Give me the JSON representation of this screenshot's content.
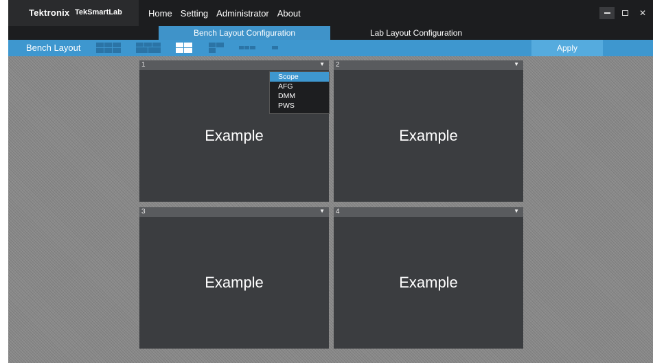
{
  "window": {
    "brand": "Tektronix",
    "app_name": "TekSmartLab",
    "menu": [
      "Home",
      "Setting",
      "Administrator",
      "About"
    ],
    "controls": [
      "minimize-icon",
      "maximize-icon",
      "close-icon"
    ]
  },
  "tabs": {
    "bench": "Bench Layout Configuration",
    "lab": "Lab Layout Configuration",
    "active": "bench"
  },
  "toolbar": {
    "label": "Bench Layout",
    "layouts": [
      "grid-2x3",
      "grid-2x3-alt",
      "grid-2x2",
      "grid-3-split",
      "row-3",
      "single"
    ],
    "selected_layout": "grid-2x2",
    "apply_label": "Apply"
  },
  "panels": [
    {
      "number": "1",
      "text": "Example"
    },
    {
      "number": "2",
      "text": "Example"
    },
    {
      "number": "3",
      "text": "Example"
    },
    {
      "number": "4",
      "text": "Example"
    }
  ],
  "dropdown": {
    "options": [
      "Scope",
      "AFG",
      "DMM",
      "PWS"
    ],
    "selected": "Scope"
  },
  "colors": {
    "accent": "#3e97cf",
    "titlebar": "#1c1d1f",
    "panel": "#3b3d40"
  }
}
